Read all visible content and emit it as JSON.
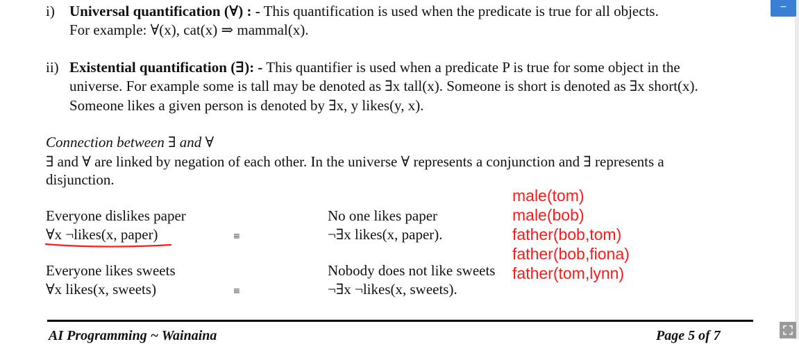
{
  "items": {
    "i": {
      "num": "i)",
      "bold": "Universal quantification (∀) : -",
      "text": " This quantification is used when the predicate is true for all objects.",
      "example": "For example: ∀(x), cat(x) ⇒ mammal(x)."
    },
    "ii": {
      "num": "ii)",
      "bold": "Existential quantification (∃): -",
      "text1": " This quantifier is used when a predicate P is true for some object in the",
      "line2": "universe. For example some is tall may be denoted as ∃x tall(x). Someone is short is denoted as ∃x short(x).",
      "line3": "Someone likes a given person is denoted by ∃x, y likes(y, x)."
    }
  },
  "connection": {
    "heading": "Connection between ∃ and ∀",
    "line1": "∃ and ∀ are linked by negation of each other. In the universe  ∀ represents a conjunction and ∃ represents a",
    "line2": "disjunction."
  },
  "examples": [
    {
      "left_text": "Everyone dislikes paper",
      "left_formula": "∀x ¬likes(x, paper)",
      "equiv": "≡",
      "right_text": "No one likes paper",
      "right_formula": "¬∃x likes(x, paper)."
    },
    {
      "left_text": "Everyone likes sweets",
      "left_formula": "∀x likes(x, sweets)",
      "equiv": "≡",
      "right_text": "Nobody does not like sweets",
      "right_formula": "¬∃x  ¬likes(x, sweets)."
    }
  ],
  "annotations": [
    "male(tom)",
    "male(bob)",
    "father(bob,tom)",
    "father(bob,fiona)",
    "father(tom,lynn)"
  ],
  "footer": {
    "left": "AI Programming ~ Wainaina",
    "right": "Page 5 of 7"
  },
  "ui": {
    "minimize_label": "−",
    "accent": "#3a7fd5",
    "annotation_color": "#ff1a1a"
  }
}
